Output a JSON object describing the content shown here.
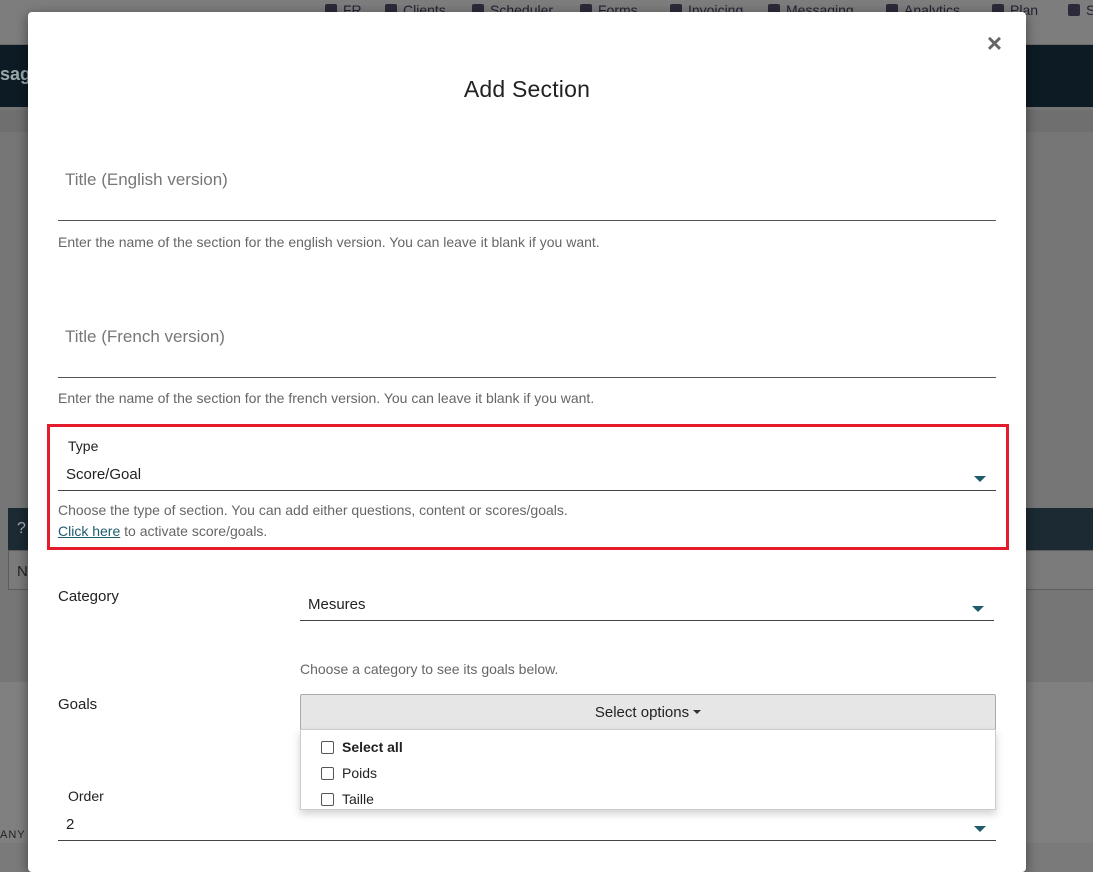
{
  "background": {
    "nav": [
      "FR",
      "Clients",
      "Scheduler",
      "Forms",
      "Invoicing",
      "Messaging",
      "Analytics",
      "Plan",
      "S"
    ],
    "banner_text": "sage",
    "table_head": "?",
    "table_row": "N",
    "footer_text": "ANY"
  },
  "modal": {
    "title": "Add Section",
    "close_glyph": "×",
    "title_en": {
      "placeholder": "Title (English version)",
      "help": "Enter the name of the section for the english version. You can leave it blank if you want."
    },
    "title_fr": {
      "placeholder": "Title (French version)",
      "help": "Enter the name of the section for the french version. You can leave it blank if you want."
    },
    "type": {
      "label": "Type",
      "value": "Score/Goal",
      "help": "Choose the type of section. You can add either questions, content or scores/goals.",
      "link_text": "Click here",
      "link_suffix": " to activate score/goals.",
      "highlight_color": "#e31b2b"
    },
    "category": {
      "label": "Category",
      "value": "Mesures",
      "help": "Choose a category to see its goals below."
    },
    "goals": {
      "label": "Goals",
      "button_label": "Select options",
      "options": [
        "Select all",
        "Poids",
        "Taille"
      ]
    },
    "order": {
      "label": "Order",
      "value": "2"
    }
  }
}
